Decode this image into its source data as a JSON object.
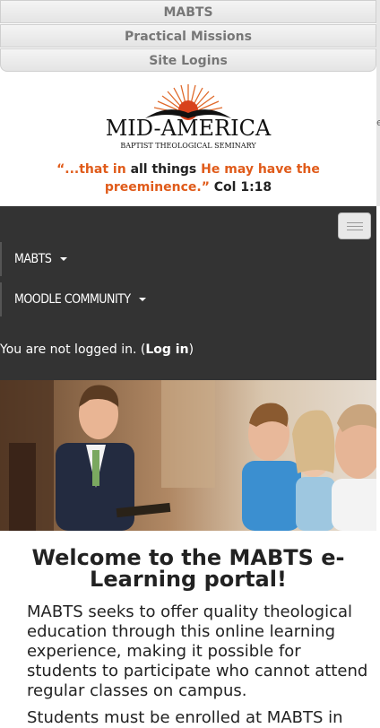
{
  "top_links": [
    "MABTS",
    "Practical Missions",
    "Site Logins"
  ],
  "logo": {
    "name": "MID-AMERICA",
    "subtitle": "BAPTIST THEOLOGICAL SEMINARY"
  },
  "tagline": {
    "part1": "“...that in",
    "part2": "all things",
    "part3": "He may have the preeminence.”",
    "part4": "Col 1:18"
  },
  "edge_fragment": "e",
  "nav": {
    "items": [
      {
        "label": "MABTS"
      },
      {
        "label": "Moodle community"
      }
    ],
    "login_prefix": "You are not logged in. (",
    "login_link": "Log in",
    "login_suffix": ")"
  },
  "content": {
    "title": "Welcome to the MABTS e-Learning portal!",
    "intro": "MABTS seeks to offer quality theological education through this online learning experience, making it possible for students to participate who cannot attend regular classes on campus.",
    "intro2": "Students must be enrolled at MABTS in"
  },
  "colors": {
    "accent": "#e05b1a",
    "navbar": "#333333"
  }
}
